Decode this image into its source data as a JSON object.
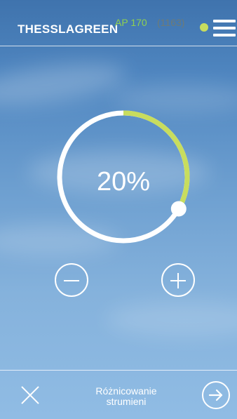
{
  "header": {
    "brand": "THESSLAGREEN",
    "model": "AP 170",
    "serial": "(1163)",
    "status_color": "#c8dd5e",
    "menu_icon": "hamburger-menu-icon"
  },
  "dial": {
    "value_text": "20%",
    "value_fraction": 0.2,
    "track_color": "#ffffff",
    "progress_color": "#c8dd5e"
  },
  "controls": {
    "decrease_icon": "minus-circle-icon",
    "increase_icon": "plus-circle-icon"
  },
  "footer": {
    "label_line1": "Różnicowanie",
    "label_line2": "strumieni",
    "close_icon": "close-icon",
    "next_icon": "arrow-right-circle-icon"
  }
}
